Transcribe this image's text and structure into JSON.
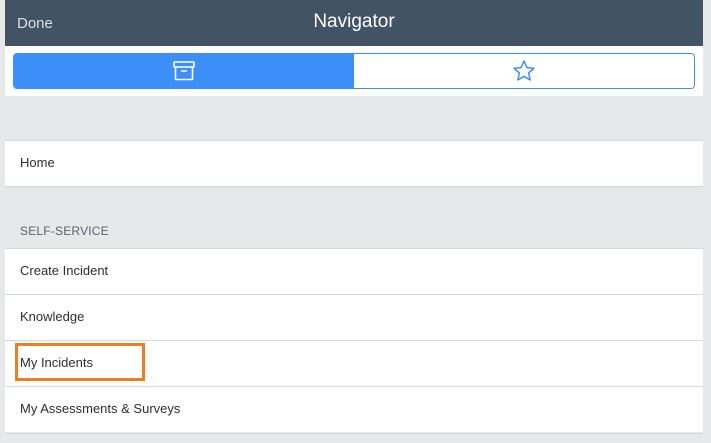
{
  "header": {
    "done_label": "Done",
    "title": "Navigator"
  },
  "segmented_control": {
    "selected": "modules",
    "options": [
      {
        "icon": "archive-box-icon",
        "active": true
      },
      {
        "icon": "star-icon",
        "active": false
      }
    ],
    "active_color": "#3c8ff7"
  },
  "list": {
    "home_label": "Home",
    "section_title": "SELF-SERVICE",
    "items": [
      {
        "label": "Create Incident"
      },
      {
        "label": "Knowledge"
      },
      {
        "label": "My Incidents",
        "highlighted": true
      },
      {
        "label": "My Assessments & Surveys"
      }
    ]
  },
  "colors": {
    "header_bg": "#425365",
    "highlight_border": "#f07d22"
  }
}
